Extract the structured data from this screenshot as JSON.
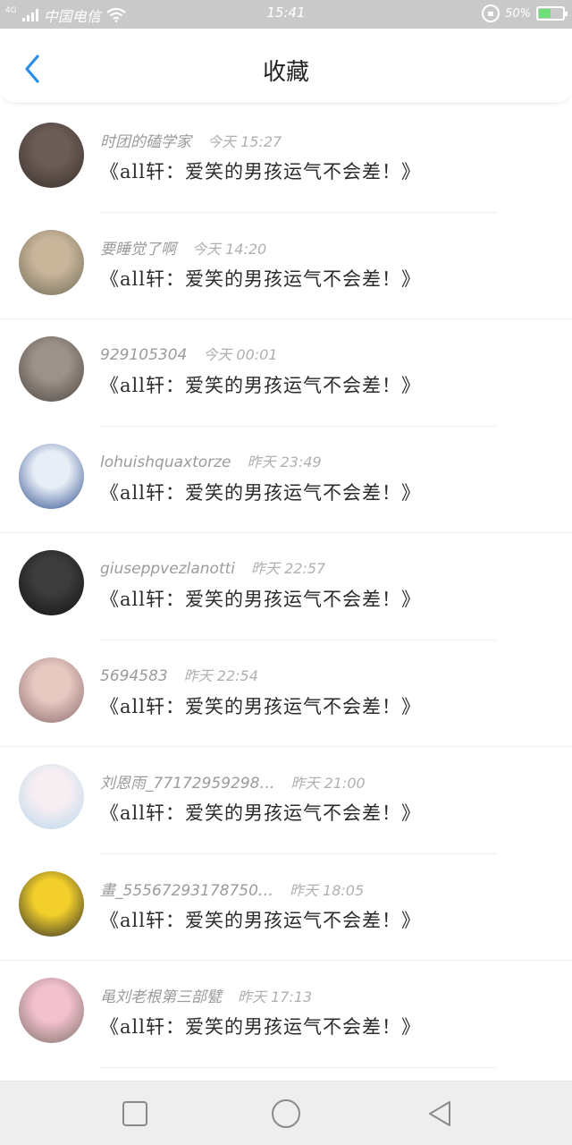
{
  "status_bar": {
    "network": "4G",
    "carrier": "中国电信",
    "time": "15:41",
    "battery_percent": "50%",
    "battery_level": 0.5,
    "battery_color": "#6ee07a"
  },
  "header": {
    "title": "收藏",
    "accent_color": "#2a8ee8"
  },
  "favorites": [
    {
      "user": "时团的磕学家",
      "time": "今天 15:27",
      "title": "《all轩：爱笑的男孩运气不会差！》",
      "avatar_colors": [
        "#6b5c55",
        "#3a2f2b"
      ]
    },
    {
      "user": "要睡觉了啊",
      "time": "今天 14:20",
      "title": "《all轩：爱笑的男孩运气不会差！》",
      "avatar_colors": [
        "#c9b59a",
        "#6e6a57"
      ]
    },
    {
      "user": "929105304",
      "time": "今天 00:01",
      "title": "《all轩：爱笑的男孩运气不会差！》",
      "avatar_colors": [
        "#9c928a",
        "#4d4540"
      ]
    },
    {
      "user": "lohuishquaxtorze",
      "time": "昨天 23:49",
      "title": "《all轩：爱笑的男孩运气不会差！》",
      "avatar_colors": [
        "#e8eef6",
        "#2c4d8f"
      ]
    },
    {
      "user": "giuseppvezlanotti",
      "time": "昨天 22:57",
      "title": "《all轩：爱笑的男孩运气不会差！》",
      "avatar_colors": [
        "#3c3c3c",
        "#111111"
      ]
    },
    {
      "user": "5694583",
      "time": "昨天 22:54",
      "title": "《all轩：爱笑的男孩运气不会差！》",
      "avatar_colors": [
        "#e6c9c0",
        "#8a6a6f"
      ]
    },
    {
      "user": "刘恩雨_77172959298…",
      "time": "昨天 21:00",
      "title": "《all轩：爱笑的男孩运气不会差！》",
      "avatar_colors": [
        "#f7eef2",
        "#b9d7ec"
      ]
    },
    {
      "user": "畫_55567293178750…",
      "time": "昨天 18:05",
      "title": "《all轩：爱笑的男孩运气不会差！》",
      "avatar_colors": [
        "#f2cf2a",
        "#2b2b2b"
      ]
    },
    {
      "user": "黾刘老根第三部甓",
      "time": "昨天 17:13",
      "title": "《all轩：爱笑的男孩运气不会差！》",
      "avatar_colors": [
        "#f3c0cf",
        "#7c7066"
      ]
    }
  ],
  "nav_bar": {
    "icons": [
      "square-icon",
      "circle-icon",
      "triangle-back-icon"
    ]
  }
}
